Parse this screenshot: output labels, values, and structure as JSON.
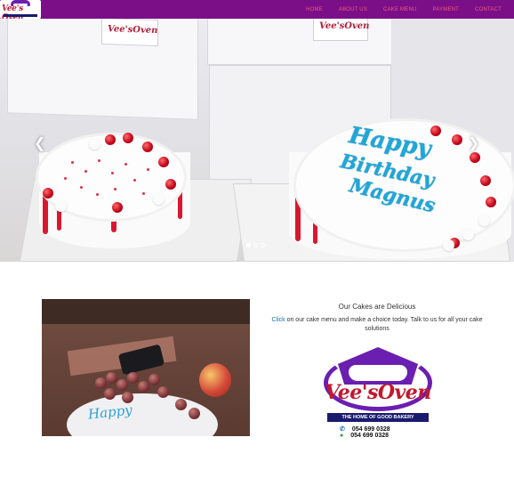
{
  "brand": {
    "logo_text": "Vee's Oven"
  },
  "nav": {
    "items": [
      {
        "label": "HOME"
      },
      {
        "label": "ABOUT US"
      },
      {
        "label": "CAKE MENU"
      },
      {
        "label": "PAYMENT"
      },
      {
        "label": "CONTACT"
      }
    ]
  },
  "carousel": {
    "slide_count": 3,
    "active_index": 0,
    "prev_icon": "chevron-left-icon",
    "next_icon": "chevron-right-icon",
    "box_label": "Vee'sOven",
    "cake_message": [
      "Happy",
      "Birthday",
      "Magnus"
    ]
  },
  "promo": {
    "title": "Our Cakes are Delicious",
    "link_text": "Click",
    "body_text": " on our cake menu and make a choice today. Talk to us for all your cake solutions"
  },
  "logo_card": {
    "brand": "Vee'sOven",
    "tagline": "THE HOME OF GOOD BAKERY",
    "phone_1": "054 699 0328",
    "phone_2": "054 699 0328"
  },
  "photo": {
    "icing_text": "Happy"
  },
  "colors": {
    "nav_bg": "#7a0f88",
    "nav_link": "#f05b7a",
    "link": "#1d6fb6",
    "brand_red": "#c3172e",
    "brand_purple": "#6a1fb0"
  }
}
